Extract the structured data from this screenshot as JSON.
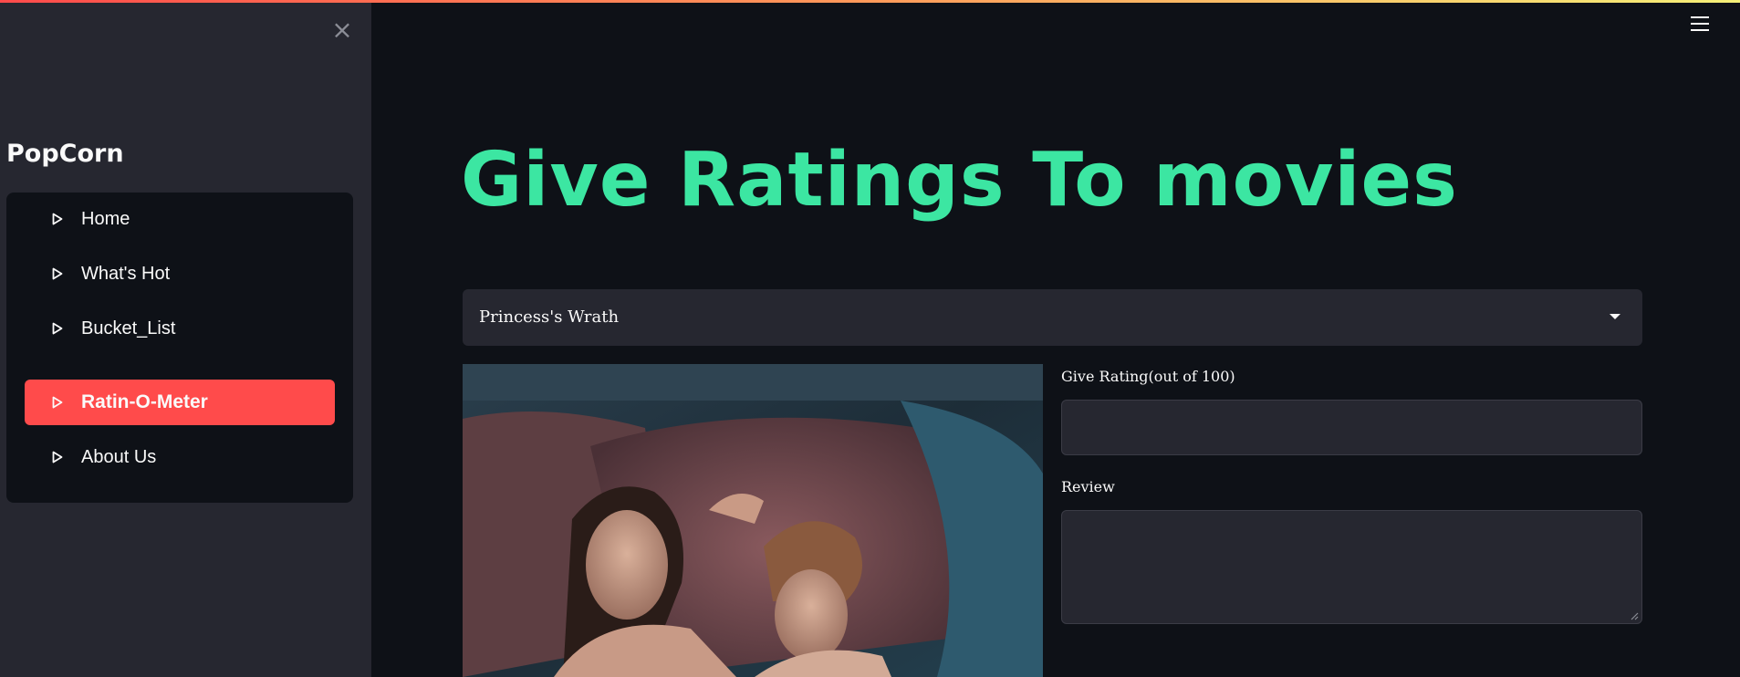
{
  "sidebar": {
    "close_icon": "close-icon",
    "brand": "PopCorn",
    "items": [
      {
        "label": "Home",
        "icon": "play-triangle-icon",
        "active": false
      },
      {
        "label": "What's Hot",
        "icon": "play-triangle-icon",
        "active": false
      },
      {
        "label": "Bucket_List",
        "icon": "play-triangle-icon",
        "active": false
      },
      {
        "label": "Ratin-O-Meter",
        "icon": "play-triangle-icon",
        "active": true
      },
      {
        "label": "About Us",
        "icon": "play-triangle-icon",
        "active": false
      }
    ]
  },
  "header": {
    "menu_icon": "hamburger-menu-icon"
  },
  "main": {
    "title": "Give Ratings To movies",
    "movie_select": {
      "selected": "Princess's Wrath"
    },
    "rating_field": {
      "label": "Give Rating(out of 100)",
      "value": ""
    },
    "review_field": {
      "label": "Review",
      "value": ""
    }
  },
  "colors": {
    "background": "#0e1117",
    "sidebar": "#262730",
    "accent": "#ff4b4b",
    "title": "#3ce6a2"
  }
}
